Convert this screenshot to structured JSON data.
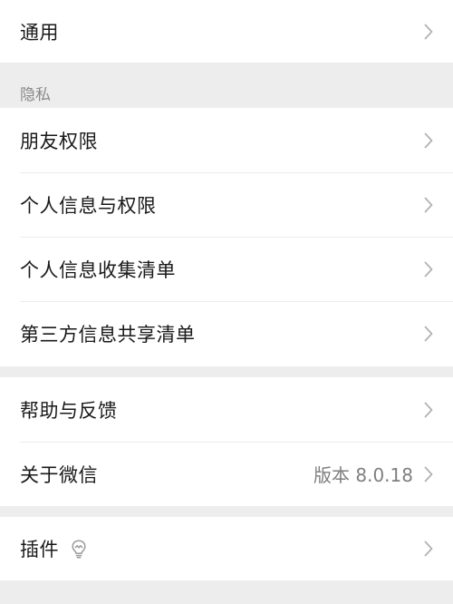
{
  "groups": {
    "general": {
      "item": {
        "label": "通用"
      }
    },
    "privacy": {
      "header": "隐私",
      "items": [
        {
          "label": "朋友权限"
        },
        {
          "label": "个人信息与权限"
        },
        {
          "label": "个人信息收集清单"
        },
        {
          "label": "第三方信息共享清单"
        }
      ]
    },
    "about": {
      "items": [
        {
          "label": "帮助与反馈"
        },
        {
          "label": "关于微信",
          "value": "版本 8.0.18"
        }
      ]
    },
    "plugins": {
      "item": {
        "label": "插件",
        "icon": "lightbulb-icon"
      }
    }
  },
  "colors": {
    "background": "#ededed",
    "card": "#ffffff",
    "text": "#191919",
    "secondary_text": "#7f7f7f",
    "chevron": "#b2b2b2"
  }
}
